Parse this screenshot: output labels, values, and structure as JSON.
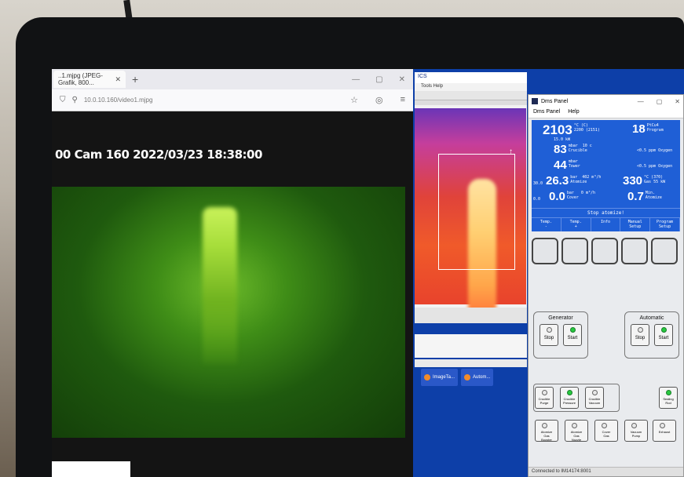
{
  "browser": {
    "tab_title": "..1.mjpg (JPEG-Grafik, 800...",
    "url": "10.0.10.160/video1.mjpg",
    "overlay": "00 Cam 160 2022/03/23 18:38:00"
  },
  "thermal": {
    "menu": "Tools   Help"
  },
  "taskbar": {
    "app1": "ImageTa...",
    "app2": "Autom..."
  },
  "dms": {
    "title": "Dms Panel",
    "menu": [
      "Dms Panel",
      "Help"
    ],
    "readouts": [
      {
        "value": "2103",
        "detail": "°C (C)\n2200 (2151)",
        "below": "15.0 kW"
      },
      {
        "value": "83",
        "detail": "mbar  10 c\nCrucible"
      },
      {
        "value": "44",
        "detail": "mbar\nTower"
      },
      {
        "value": "26.3",
        "detail": "bar  402 m³/h\nAtomize",
        "left": "30.0"
      },
      {
        "value": "0.0",
        "detail": "bar   0 m³/h\nCover",
        "left": "0.0"
      }
    ],
    "readouts_right": [
      {
        "value": "18",
        "detail": "PtCu4\nProgram"
      },
      {
        "value": "",
        "detail": "<0.5 ppm Oxygen"
      },
      {
        "value": "",
        "detail": "<0.5 ppm Oxygen"
      },
      {
        "value": "330",
        "detail": "°C (370)\nGas 55 kW"
      },
      {
        "value": "0.7",
        "detail": "Min.\nAtomize"
      }
    ],
    "banner": "Stop atomize!",
    "tabs": [
      "Temp.\n-",
      "Temp.\n+",
      "Info",
      "Manual\nSetup",
      "Program\nSetup"
    ],
    "generator": {
      "label": "Generator",
      "stop": "Stop",
      "start": "Start"
    },
    "automatic": {
      "label": "Automatic",
      "stop": "Stop",
      "start": "Start"
    },
    "row1": [
      "Crucible\nPurge",
      "Crucible\nPressure",
      "Crucible\nVacuum"
    ],
    "row1_right": "Sealing\nRod",
    "row2": [
      "Atomize\nGas\nBooster",
      "Atomize\nGas\nNozzle",
      "Cover\nGas",
      "Vacuum\nPump",
      "Exhaust"
    ],
    "status": "Connected to IM14174:8001"
  }
}
